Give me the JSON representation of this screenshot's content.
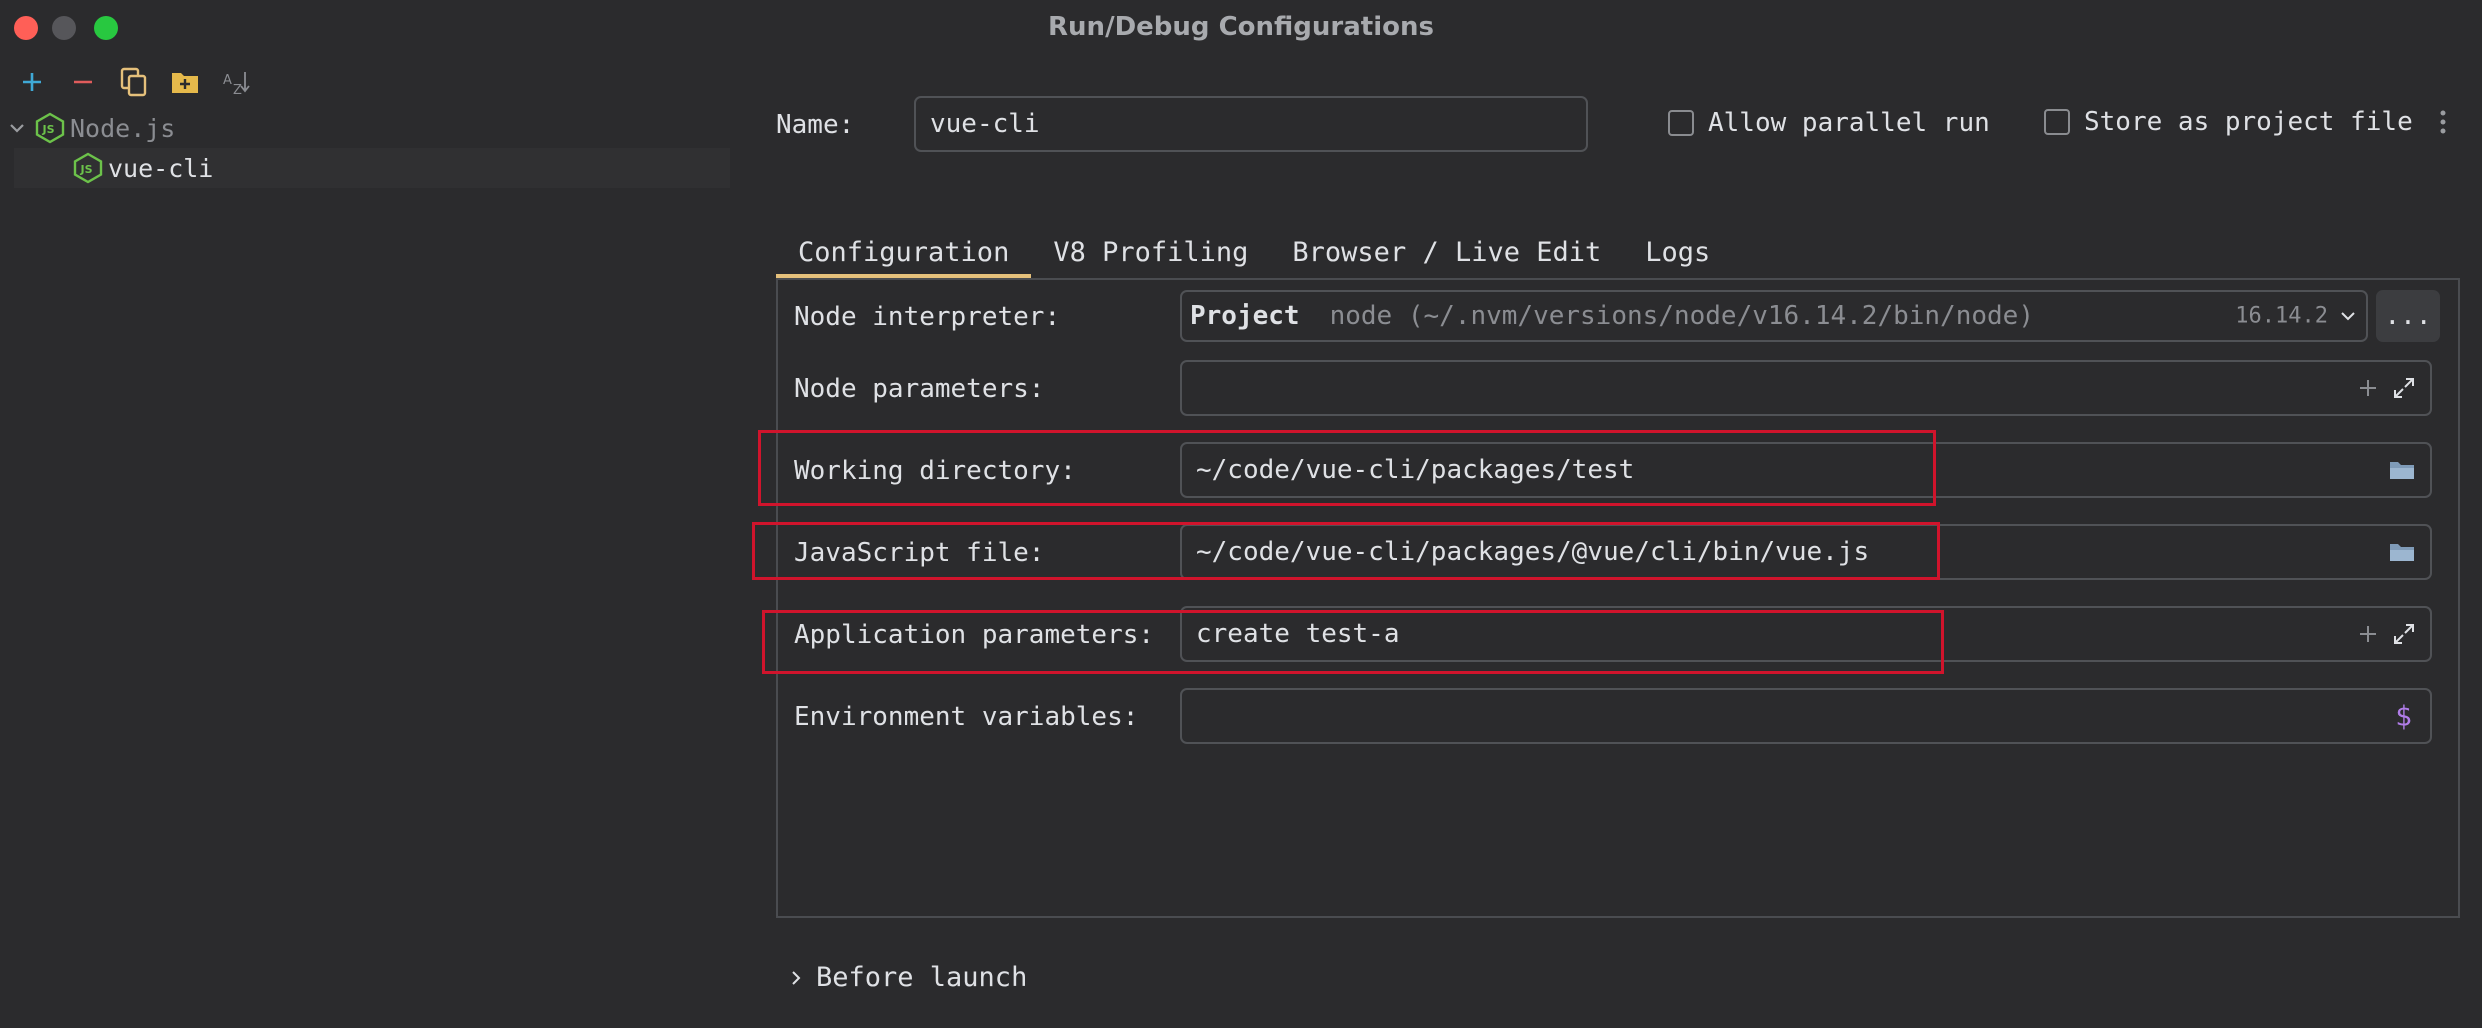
{
  "window": {
    "title": "Run/Debug Configurations"
  },
  "toolbar": {
    "icons": [
      "add-icon",
      "remove-icon",
      "copy-icon",
      "new-folder-icon",
      "sort-alpha-icon"
    ]
  },
  "tree": {
    "group_label": "Node.js",
    "item_label": "vue-cli"
  },
  "header": {
    "name_label": "Name:",
    "name_value": "vue-cli",
    "allow_parallel_label": "Allow parallel run",
    "store_project_label": "Store as project file"
  },
  "tabs": [
    {
      "label": "Configuration",
      "active": true
    },
    {
      "label": "V8 Profiling",
      "active": false
    },
    {
      "label": "Browser / Live Edit",
      "active": false
    },
    {
      "label": "Logs",
      "active": false
    }
  ],
  "fields": {
    "interpreter_label": "Node interpreter:",
    "interpreter_scope": "Project",
    "interpreter_path": "node (~/.nvm/versions/node/v16.14.2/bin/node)",
    "interpreter_version": "16.14.2",
    "browse_label": "...",
    "node_params_label": "Node parameters:",
    "node_params_value": "",
    "workdir_label": "Working directory:",
    "workdir_value": "~/code/vue-cli/packages/test",
    "jsfile_label": "JavaScript file:",
    "jsfile_value": "~/code/vue-cli/packages/@vue/cli/bin/vue.js",
    "app_params_label": "Application parameters:",
    "app_params_value": "create test-a",
    "env_label": "Environment variables:",
    "env_value": "",
    "env_icon_glyph": "$"
  },
  "before_launch": {
    "label": "Before launch"
  },
  "colors": {
    "accent_tab": "#e5c07b",
    "highlight": "#d0142c",
    "nodejs_green": "#6cc24a",
    "env_purple": "#b07ce8"
  }
}
